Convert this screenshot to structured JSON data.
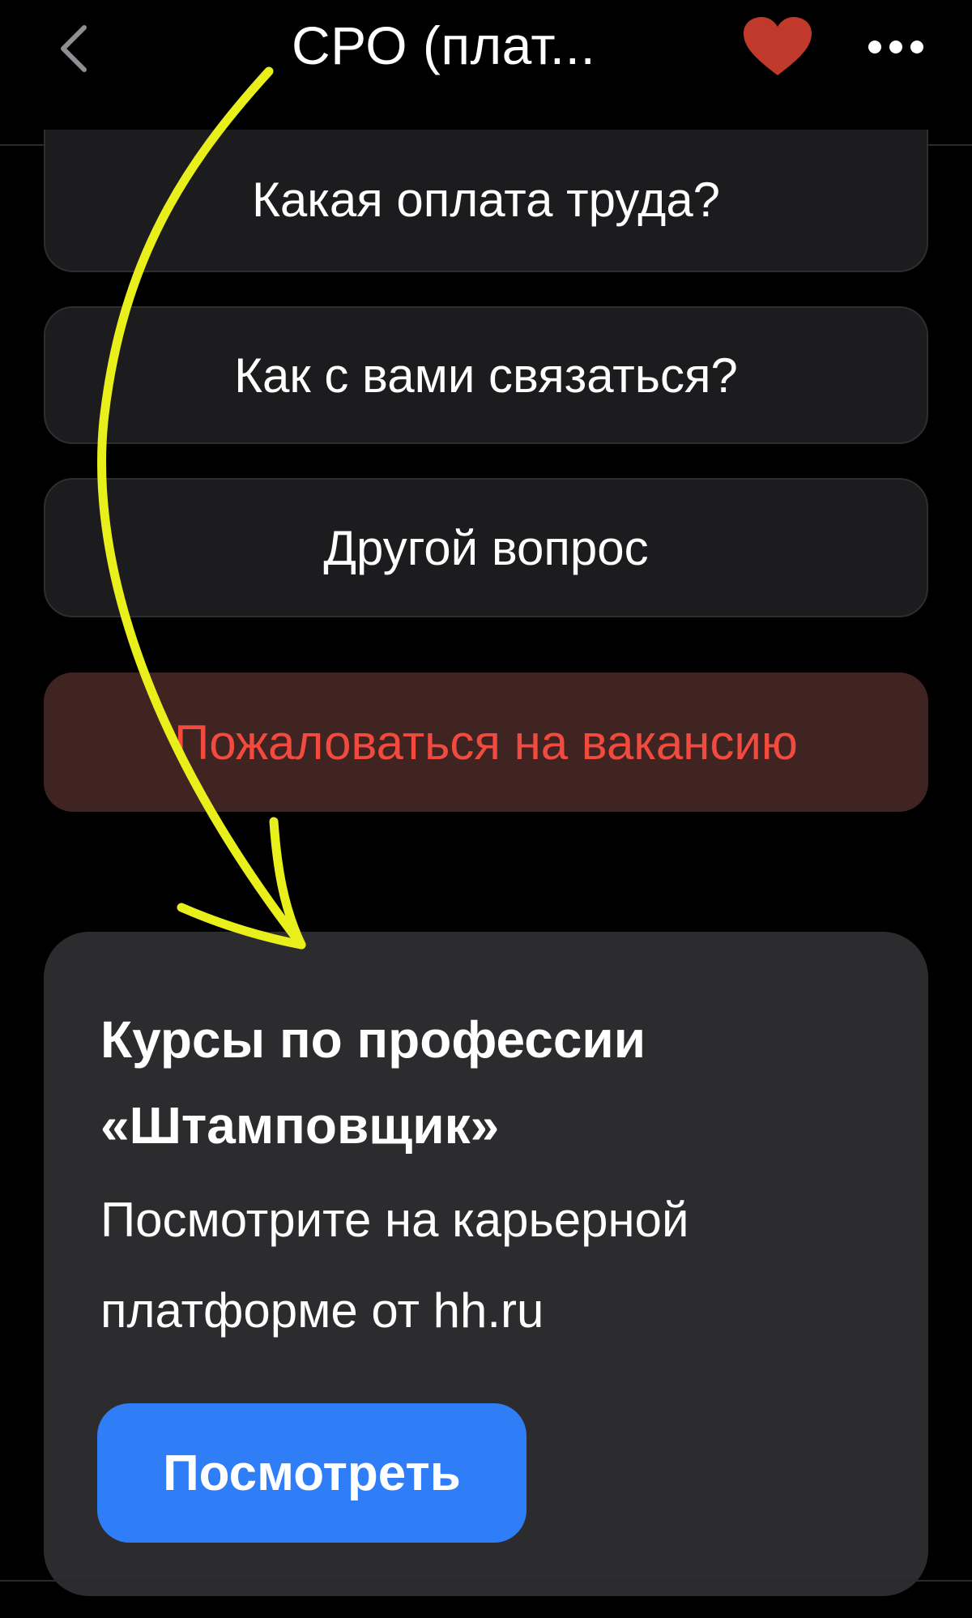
{
  "header": {
    "title": "СРО (плат...",
    "back_icon": "chevron-left-icon",
    "favorite_icon": "heart-icon",
    "favorite_color": "#c0392b",
    "more_icon": "more-horizontal-icon"
  },
  "questions": [
    {
      "label": "Какая оплата труда?"
    },
    {
      "label": "Как с вами связаться?"
    },
    {
      "label": "Другой вопрос"
    }
  ],
  "complaint": {
    "label": "Пожаловаться на вакансию",
    "color": "#f24a3e"
  },
  "promo": {
    "title": "Курсы по профессии «Штамповщик»",
    "subtitle": "Посмотрите на карьерной платформе от hh.ru",
    "button_label": "Посмотреть",
    "button_color": "#2f7ef7"
  },
  "annotation": {
    "arrow_color": "#e8ef1a"
  }
}
